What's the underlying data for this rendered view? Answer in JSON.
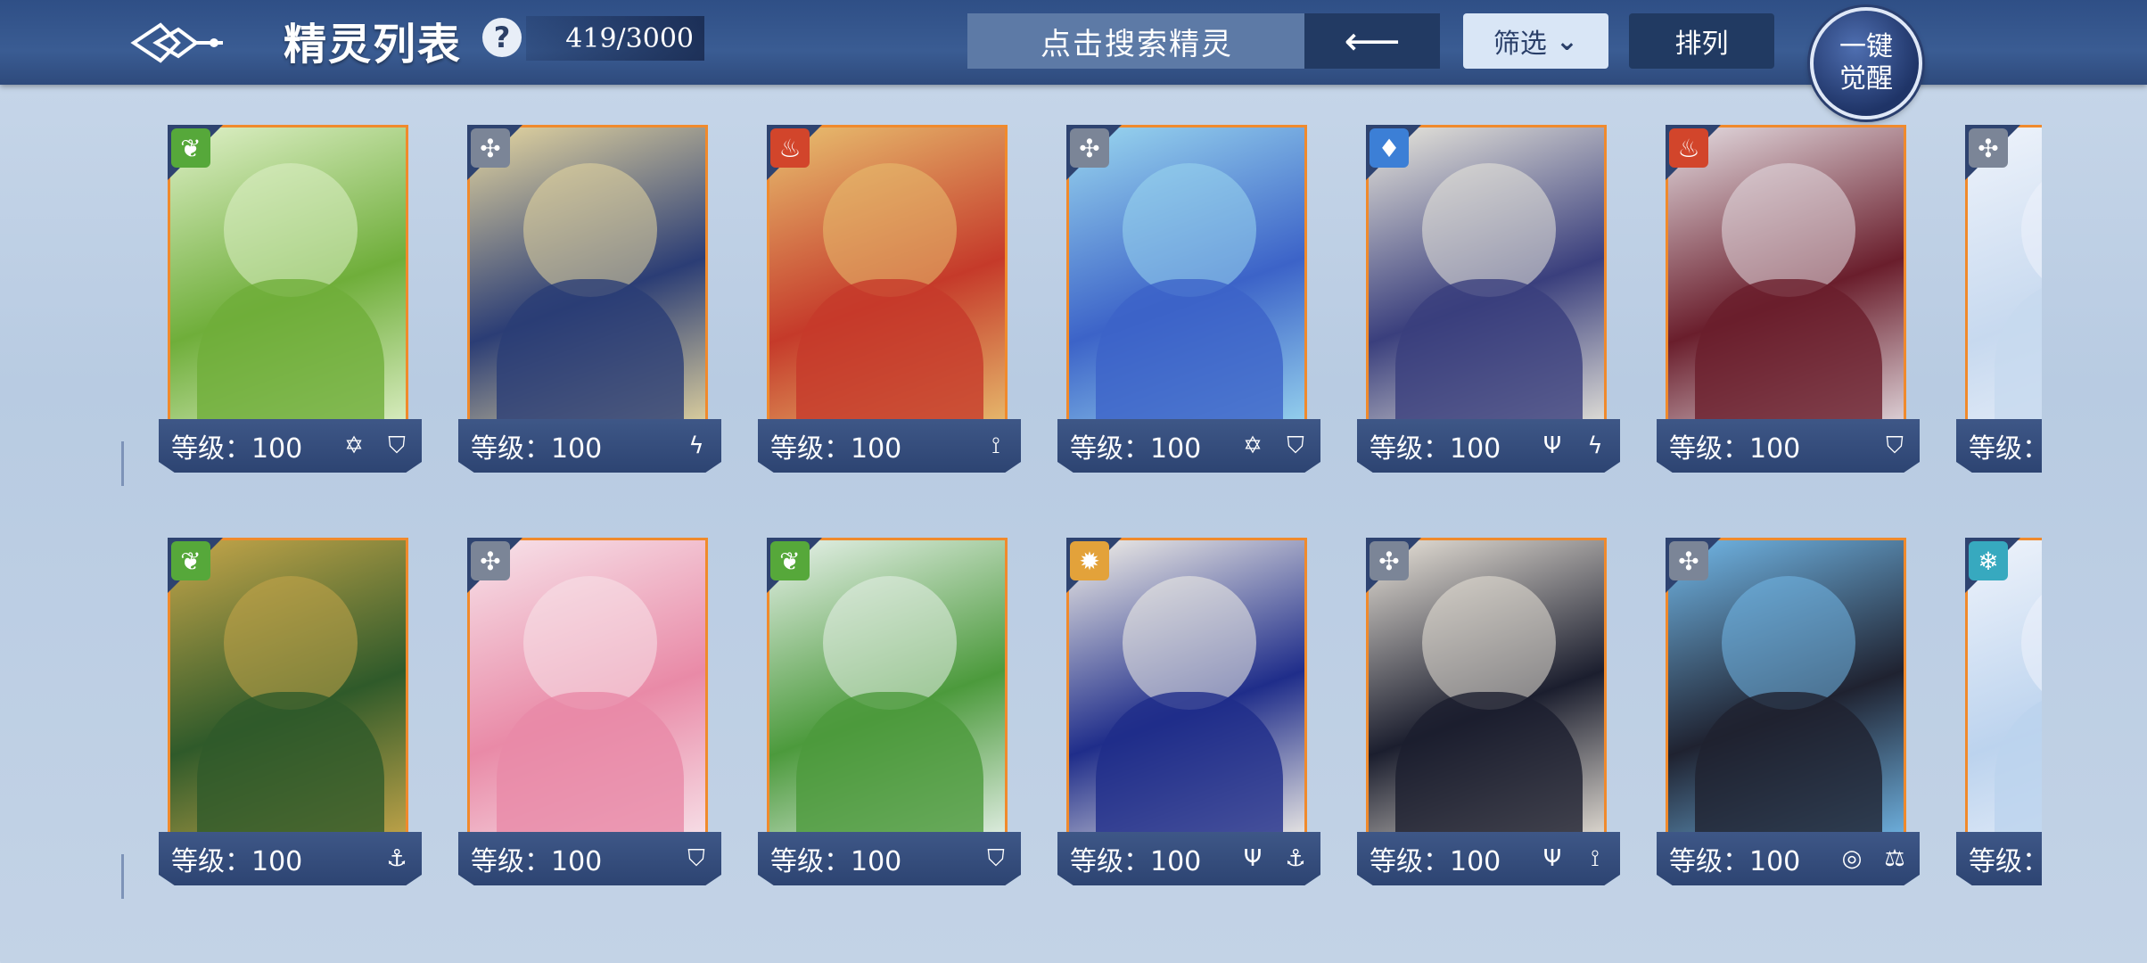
{
  "header": {
    "title": "精灵列表",
    "help_label": "?",
    "count": "419/3000",
    "search_placeholder": "点击搜索精灵",
    "back_label": "⟵",
    "filter_label": "筛选",
    "filter_arrow": "⌄",
    "sort_label": "排列",
    "awaken_line1": "一键",
    "awaken_line2": "觉醒"
  },
  "colors": {
    "topbar": "#2f4f86",
    "card_border": "#f08a2c",
    "footer": "#2d4472"
  },
  "rows": [
    [
      {
        "level": "等级：100",
        "element": "grass-icon",
        "art": [
          "#6fae3a",
          "#dff0c8"
        ],
        "icons": [
          "star-shield-icon",
          "shield-icon"
        ]
      },
      {
        "level": "等级：100",
        "element": "neutral-icon",
        "art": [
          "#2b3d75",
          "#e6d7a0"
        ],
        "icons": [
          "lightning-icon"
        ]
      },
      {
        "level": "等级：100",
        "element": "fire-icon",
        "art": [
          "#c53a2a",
          "#e8c070"
        ],
        "icons": [
          "claw-icon"
        ]
      },
      {
        "level": "等级：100",
        "element": "neutral-icon",
        "art": [
          "#3c63c8",
          "#9ad7ef"
        ],
        "icons": [
          "star-shield-icon",
          "shield-icon"
        ]
      },
      {
        "level": "等级：100",
        "element": "water-icon",
        "art": [
          "#3a3f7d",
          "#e9e7dc"
        ],
        "icons": [
          "trident-icon",
          "lightning-icon"
        ]
      },
      {
        "level": "等级：100",
        "element": "fire-icon",
        "art": [
          "#6a1e2c",
          "#e4dce1"
        ],
        "icons": [
          "shield-icon"
        ]
      },
      {
        "level": "等级：",
        "element": "neutral-icon",
        "art": [
          "#c7d9ef",
          "#eef3fb"
        ],
        "icons": []
      }
    ],
    [
      {
        "level": "等级：100",
        "element": "grass-icon",
        "art": [
          "#2f5a2a",
          "#c6a64a"
        ],
        "icons": [
          "cross-ship-icon"
        ]
      },
      {
        "level": "等级：100",
        "element": "neutral-icon",
        "art": [
          "#e98aa7",
          "#f7e3ea"
        ],
        "icons": [
          "shield-icon"
        ]
      },
      {
        "level": "等级：100",
        "element": "grass-icon",
        "art": [
          "#4c9a3c",
          "#e7f1ea"
        ],
        "icons": [
          "shield-icon"
        ]
      },
      {
        "level": "等级：100",
        "element": "light-icon",
        "art": [
          "#1f2d8a",
          "#f3f0e8"
        ],
        "icons": [
          "trident-icon",
          "cross-ship-icon"
        ]
      },
      {
        "level": "等级：100",
        "element": "neutral-icon",
        "art": [
          "#1b1e2e",
          "#e9e3d9"
        ],
        "icons": [
          "trident-icon",
          "claw-icon"
        ]
      },
      {
        "level": "等级：100",
        "element": "neutral-icon",
        "art": [
          "#1f2230",
          "#72b8e8"
        ],
        "icons": [
          "swirl-icon",
          "scale-icon"
        ]
      },
      {
        "level": "等级：",
        "element": "ice-icon",
        "art": [
          "#bcd3ee",
          "#eef3fb"
        ],
        "icons": []
      }
    ]
  ]
}
